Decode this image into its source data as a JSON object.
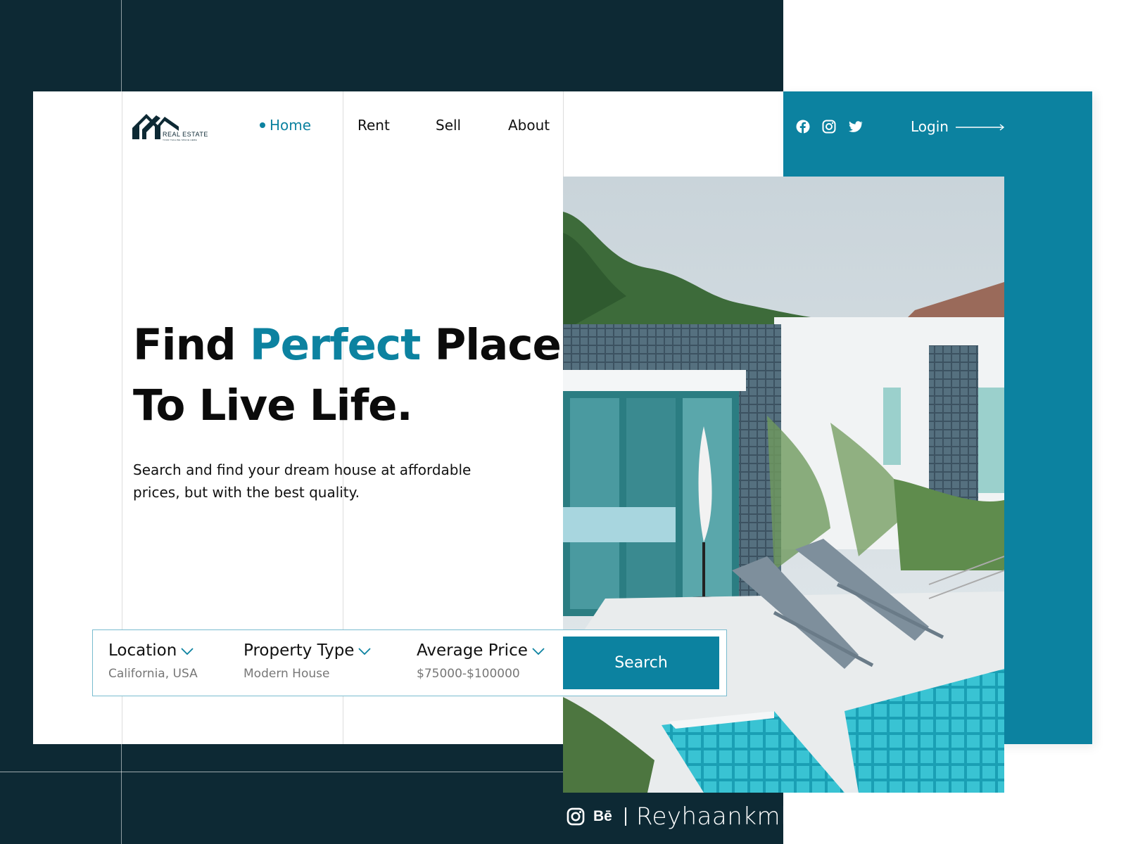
{
  "brand": {
    "name": "REAL ESTATE",
    "tagline": "YOUR TAGLINE SPACE HERE"
  },
  "nav": {
    "items": [
      {
        "label": "Home",
        "active": true
      },
      {
        "label": "Rent",
        "active": false
      },
      {
        "label": "Sell",
        "active": false
      },
      {
        "label": "About",
        "active": false
      }
    ]
  },
  "header_right": {
    "social_icons": [
      "facebook-icon",
      "instagram-icon",
      "twitter-icon"
    ],
    "login_label": "Login"
  },
  "hero": {
    "title_part1": "Find ",
    "title_accent": "Perfect",
    "title_part2": " Place",
    "title_line2": "To Live Life.",
    "description": "Search and find your dream house at affordable prices, but with the best quality."
  },
  "search": {
    "fields": [
      {
        "label": "Location",
        "value": "California, USA"
      },
      {
        "label": "Property Type",
        "value": "Modern House"
      },
      {
        "label": "Average Price",
        "value": "$75000-$100000"
      }
    ],
    "button_label": "Search"
  },
  "credit": {
    "behance": "Bē",
    "author": "Reyhaankml"
  },
  "colors": {
    "accent": "#0c82a0",
    "dark": "#0d2934",
    "text": "#0b0b0b",
    "muted": "#777777"
  }
}
